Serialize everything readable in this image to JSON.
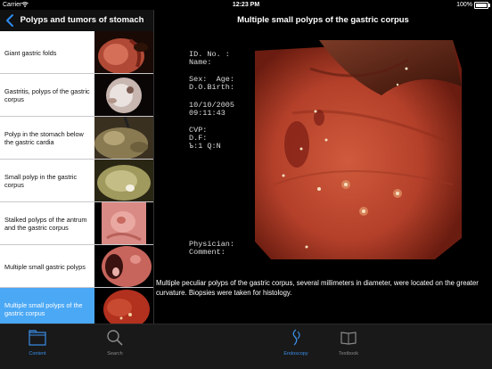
{
  "status": {
    "carrier": "Carrier",
    "time": "12:23 PM",
    "battery": "100%"
  },
  "sidebar": {
    "title": "Polyps and tumors of stomach",
    "items": [
      {
        "label": "Giant gastric folds"
      },
      {
        "label": "Gastritis, polyps of the gastric corpus"
      },
      {
        "label": "Polyp in the stomach below the gastric cardia"
      },
      {
        "label": "Small polyp in the gastric corpus"
      },
      {
        "label": "Stalked polyps of the antrum and the gastric corpus"
      },
      {
        "label": "Multiple small gastric polyps"
      },
      {
        "label": "Multiple small polyps of the gastric corpus"
      }
    ]
  },
  "main": {
    "title": "Multiple small polyps of the gastric corpus",
    "overlay": {
      "id": "ID. No. :",
      "name": "Name:",
      "sex_age": "Sex:  Age:",
      "dob": "D.O.Birth:",
      "date": "10/10/2005",
      "time": "09:11:43",
      "cvp": "CVP:",
      "df": "D.F:",
      "param": "Ъ:1 Q:N",
      "physician": "Physician:",
      "comment": "Comment:"
    },
    "caption": "Multiple peculiar polyps of the gastric corpus, several millimeters in diameter, were located on the greater curvature. Biopsies were taken for histology."
  },
  "tabs": {
    "content": "Content",
    "search": "Search",
    "endoscopy": "Endoscopy",
    "textbook": "Textbook"
  },
  "colors": {
    "accent": "#4aa8f5",
    "selected_row": "#4aa8f5"
  }
}
